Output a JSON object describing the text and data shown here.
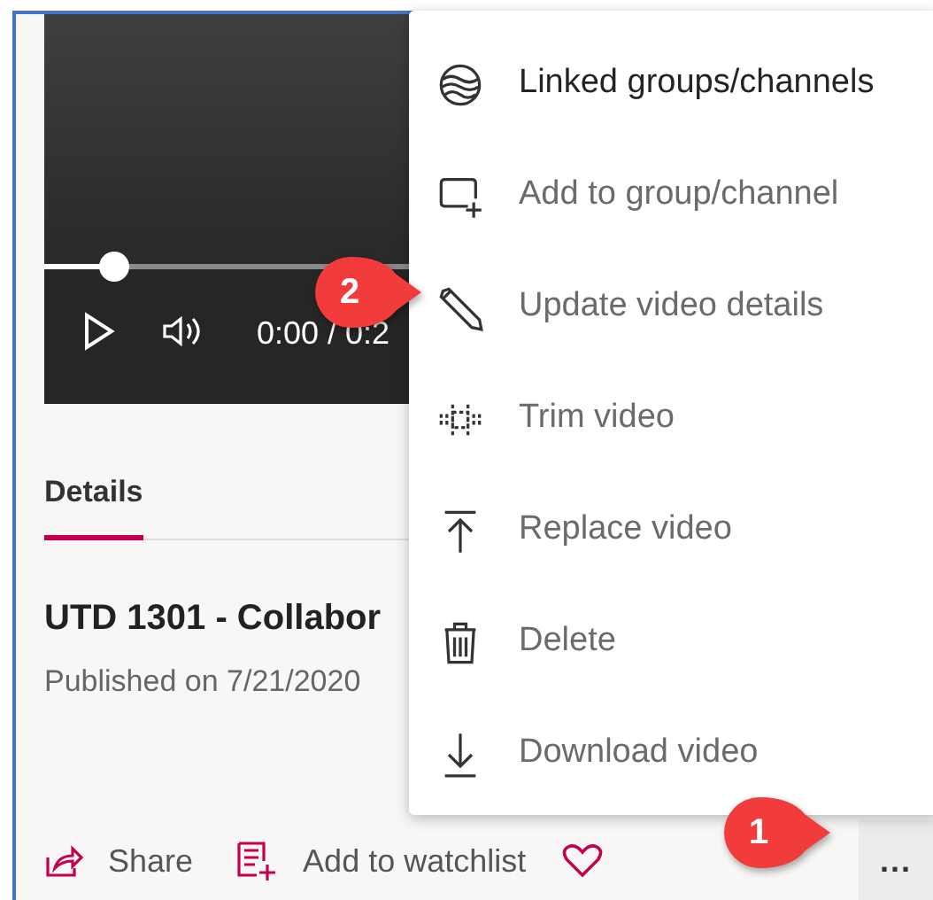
{
  "video": {
    "time": "0:00 / 0:2"
  },
  "tabs": [
    {
      "label": "Details",
      "selected": true
    }
  ],
  "details": {
    "title": "UTD 1301 - Collabor",
    "published": "Published on 7/21/2020"
  },
  "actions": [
    {
      "kind": "share",
      "label": "Share"
    },
    {
      "kind": "watchlist",
      "label": "Add to watchlist"
    },
    {
      "kind": "like"
    },
    {
      "kind": "more",
      "label": "..."
    }
  ],
  "menu": [
    {
      "kind": "linked",
      "label": "Linked groups/channels",
      "disabled": false
    },
    {
      "kind": "add",
      "label": "Add to group/channel",
      "disabled": true
    },
    {
      "kind": "edit",
      "label": "Update video details",
      "disabled": true
    },
    {
      "kind": "trim",
      "label": "Trim video",
      "disabled": true
    },
    {
      "kind": "replace",
      "label": "Replace video",
      "disabled": true
    },
    {
      "kind": "delete",
      "label": "Delete",
      "disabled": true
    },
    {
      "kind": "download",
      "label": "Download video",
      "disabled": true
    }
  ],
  "callouts": [
    {
      "kind": "edit",
      "label": "2"
    },
    {
      "kind": "more",
      "label": "1"
    }
  ]
}
